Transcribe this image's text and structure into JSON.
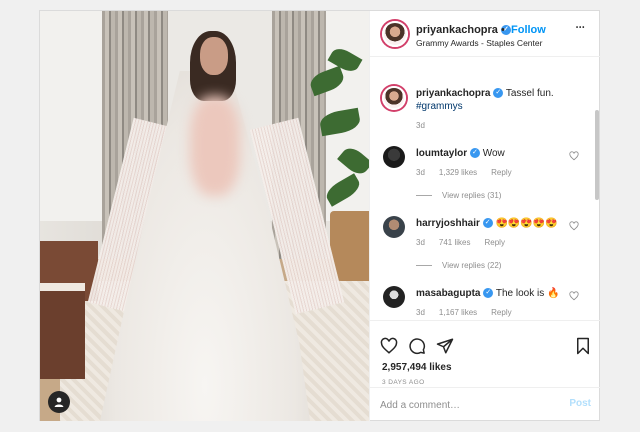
{
  "author": {
    "username": "priyankachopra",
    "follow_label": "Follow",
    "separator": "•",
    "location": "Grammy Awards - Staples Center",
    "more_glyph": "•••"
  },
  "caption": {
    "username": "priyankachopra",
    "text": "Tassel fun.",
    "hashtag": "#grammys",
    "age": "3d"
  },
  "comments": [
    {
      "username": "loumtaylor",
      "text": "Wow",
      "age": "3d",
      "likes": "1,329 likes",
      "reply": "Reply",
      "view_replies": "View replies (31)"
    },
    {
      "username": "harryjoshhair",
      "text": "😍😍😍😍😍",
      "age": "3d",
      "likes": "741 likes",
      "reply": "Reply",
      "view_replies": "View replies (22)"
    },
    {
      "username": "masabagupta",
      "text": "The look is 🔥",
      "age": "3d",
      "likes": "1,167 likes",
      "reply": "Reply"
    }
  ],
  "actions": {
    "like_icon": "heart-icon",
    "comment_icon": "comment-icon",
    "share_icon": "share-icon",
    "save_icon": "bookmark-icon",
    "likes_count": "2,957,494 likes",
    "posted": "3 DAYS AGO"
  },
  "add_comment": {
    "placeholder": "Add a comment…",
    "post_label": "Post"
  },
  "colors": {
    "accent": "#0095f6",
    "verified": "#3897f0",
    "post_disabled": "#b2dffc",
    "story_ring": "#d23f6a"
  }
}
